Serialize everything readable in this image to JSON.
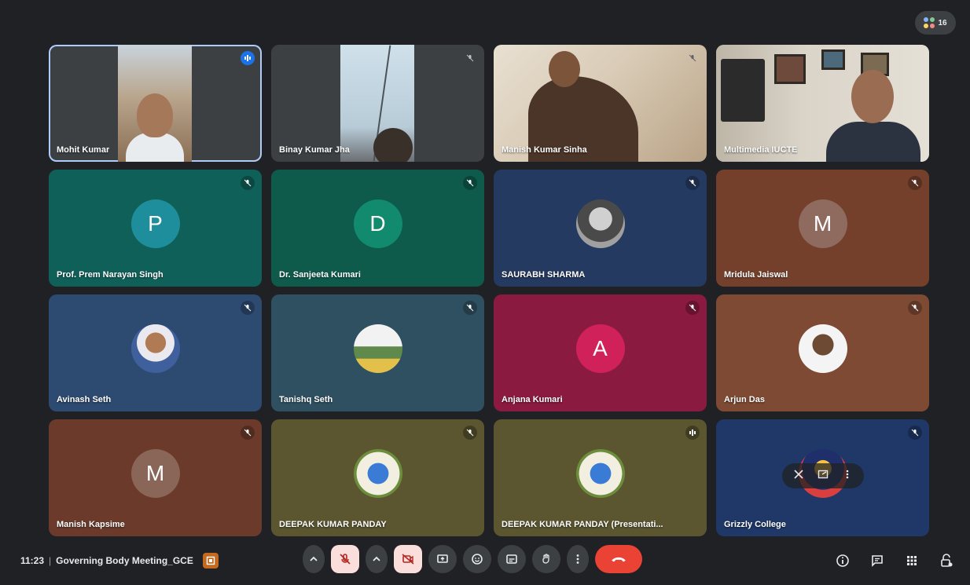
{
  "top_chip": {
    "count": "16"
  },
  "tiles": [
    {
      "name": "Mohit Kumar",
      "kind": "video",
      "mic": "speaking-icon"
    },
    {
      "name": "Binay Kumar Jha",
      "kind": "video",
      "mic": "mic-off-icon"
    },
    {
      "name": "Manish Kumar Sinha",
      "kind": "video",
      "mic": "mic-off-icon"
    },
    {
      "name": "Multimedia IUCTE",
      "kind": "video",
      "mic": "none"
    },
    {
      "name": "Prof. Prem Narayan Singh",
      "initial": "P",
      "bg": "#10605a",
      "avatar": "#1f8e9c",
      "mic": "mic-off-icon"
    },
    {
      "name": "Dr. Sanjeeta Kumari",
      "initial": "D",
      "bg": "#0e5b4c",
      "avatar": "#128a6d",
      "mic": "mic-off-icon"
    },
    {
      "name": "SAURABH SHARMA",
      "kind": "photo",
      "bg": "#253a61",
      "mic": "mic-off-icon"
    },
    {
      "name": "Mridula Jaiswal",
      "initial": "M",
      "bg": "#74402c",
      "avatar": "#8f6a5f",
      "mic": "mic-off-icon"
    },
    {
      "name": "Avinash Seth",
      "kind": "photo",
      "bg": "#2d4a70",
      "mic": "mic-off-icon"
    },
    {
      "name": "Tanishq Seth",
      "kind": "photo",
      "bg": "#2f5060",
      "mic": "mic-off-icon"
    },
    {
      "name": "Anjana Kumari",
      "initial": "A",
      "bg": "#8a1a40",
      "avatar": "#d0215a",
      "mic": "mic-off-icon"
    },
    {
      "name": "Arjun Das",
      "kind": "photo",
      "bg": "#7e4a33",
      "mic": "mic-off-icon"
    },
    {
      "name": "Manish Kapsime",
      "initial": "M",
      "bg": "#6b3a2a",
      "avatar": "#8a6659",
      "mic": "mic-off-icon"
    },
    {
      "name": "DEEPAK KUMAR PANDAY",
      "kind": "butterfly",
      "bg": "#5b5630",
      "mic": "mic-off-icon"
    },
    {
      "name": "DEEPAK KUMAR PANDAY (Presentati...",
      "kind": "butterfly",
      "bg": "#5b5630",
      "mic": "speaking-icon"
    },
    {
      "name": "Grizzly College",
      "kind": "logo",
      "bg": "#1f3868",
      "mic": "mic-off-icon"
    }
  ],
  "bottom": {
    "time": "11:23",
    "separator": "|",
    "meeting_name": "Governing Body Meeting_GCE"
  },
  "colors": {
    "background": "#202124",
    "end_call": "#ea4335",
    "muted_button_bg": "#f9dedc",
    "accent": "#8ab4f8"
  }
}
